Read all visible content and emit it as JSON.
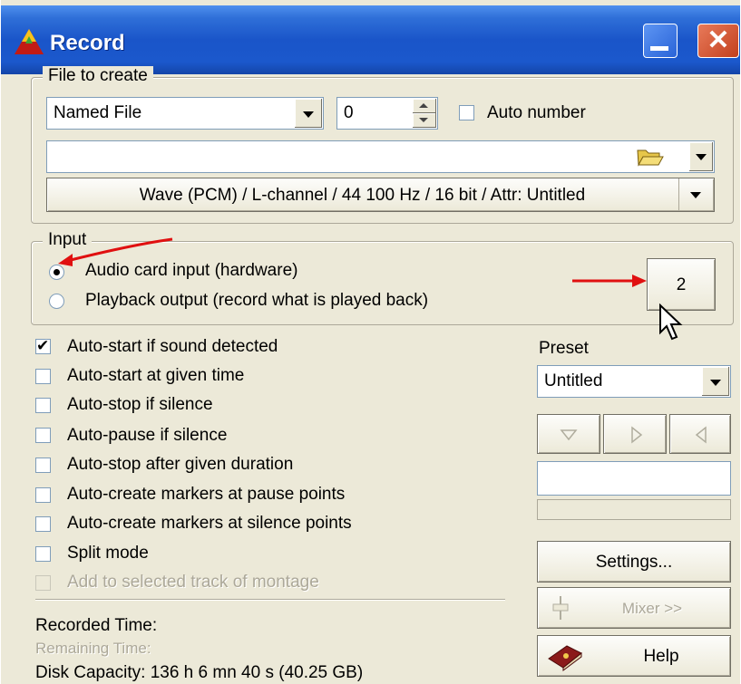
{
  "window": {
    "title": "Record"
  },
  "file_group": {
    "label": "File to create",
    "type_select": "Named File",
    "number_value": "0",
    "auto_number_label": "Auto number",
    "auto_number_checked": true,
    "filename_value": "",
    "format_button": "Wave (PCM) / L-channel / 44 100 Hz / 16 bit / Attr: Untitled"
  },
  "input_group": {
    "label": "Input",
    "options": [
      {
        "label": "Audio card input (hardware)",
        "selected": true
      },
      {
        "label": "Playback output (record what is played back)",
        "selected": false
      }
    ],
    "device_button": "2"
  },
  "options": [
    {
      "label": "Auto-start if sound detected",
      "checked": true
    },
    {
      "label": "Auto-start at given time",
      "checked": false
    },
    {
      "label": "Auto-stop if silence",
      "checked": false
    },
    {
      "label": "Auto-pause if silence",
      "checked": false
    },
    {
      "label": "Auto-stop after given duration",
      "checked": false
    },
    {
      "label": "Auto-create markers at pause points",
      "checked": false
    },
    {
      "label": "Auto-create markers at silence points",
      "checked": false
    },
    {
      "label": "Split mode",
      "checked": false
    },
    {
      "label": "Add to selected track of montage",
      "checked": false,
      "disabled": true
    }
  ],
  "preset": {
    "label": "Preset",
    "value": "Untitled"
  },
  "buttons": {
    "settings": "Settings...",
    "mixer": "Mixer >>",
    "help": "Help"
  },
  "status": {
    "recorded_time": "Recorded Time:",
    "remaining_time": "Remaining Time:",
    "disk_capacity": "Disk Capacity: 136 h 6 mn 40 s (40.25 GB)"
  },
  "colors": {
    "titlebar": "#1a55c9",
    "window_bg": "#ece9d8",
    "annotation_arrow": "#e01010"
  }
}
